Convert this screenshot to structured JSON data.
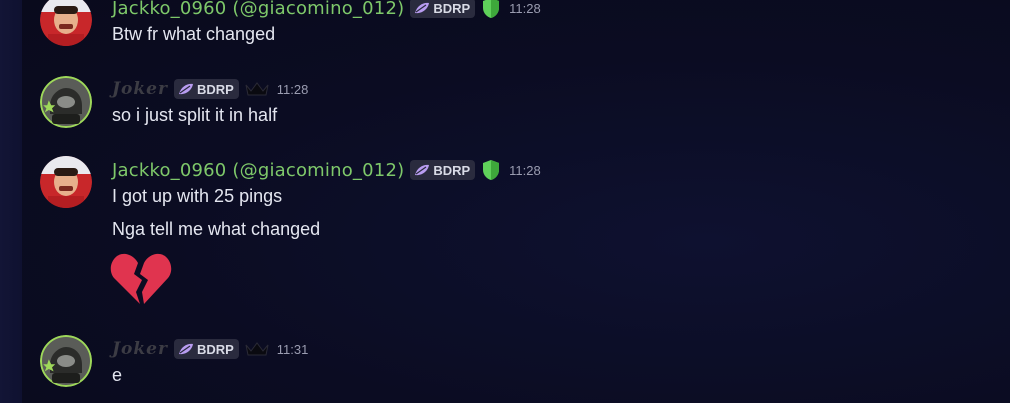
{
  "messages": [
    {
      "author": "Jackko_0960",
      "handle": "(@giacomino_012)",
      "tag": "BDRP",
      "time": "11:28",
      "lines": [
        "Btw fr what changed"
      ]
    },
    {
      "author": "Joker",
      "tag": "BDRP",
      "time": "11:28",
      "lines": [
        "so i just split it in half"
      ]
    },
    {
      "author": "Jackko_0960",
      "handle": "(@giacomino_012)",
      "tag": "BDRP",
      "time": "11:28",
      "lines": [
        "I got up with 25 pings",
        "Nga tell me what changed"
      ],
      "emoji": "broken-heart-icon"
    },
    {
      "author": "Joker",
      "tag": "BDRP",
      "time": "11:31",
      "lines": [
        "e"
      ]
    }
  ],
  "colors": {
    "background": "#0b0c22",
    "username_green": "#7ec86a",
    "message_text": "#e4e6f0",
    "timestamp": "#9a9cb0",
    "tag_bg": "#2a2b3e",
    "tag_icon": "#b89cf0",
    "shield_green": "#5fd15a",
    "heart_red": "#e0344f"
  }
}
